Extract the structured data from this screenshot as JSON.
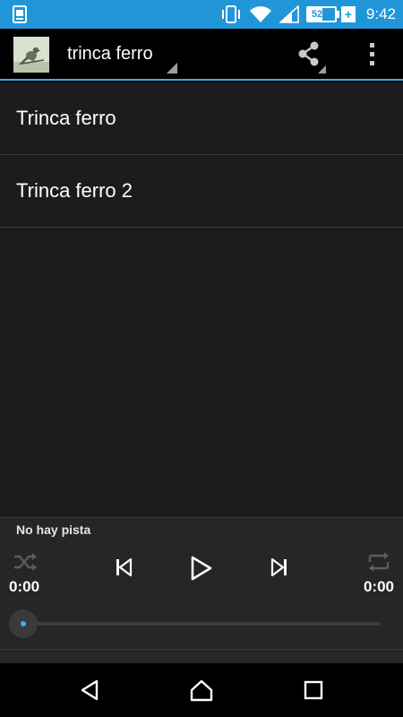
{
  "status_bar": {
    "time": "9:42",
    "battery_text": "52%",
    "battery_level": 0.52,
    "charging_glyph": "+",
    "icons": [
      "screenshot-notification-icon",
      "vibrate-icon",
      "wifi-icon",
      "cell-signal-icon",
      "battery-icon"
    ]
  },
  "action_bar": {
    "title": "trinca ferro",
    "thumbnail": "bird-thumbnail",
    "icons": [
      "share-icon",
      "overflow-menu-icon"
    ]
  },
  "list": {
    "items": [
      {
        "label": "Trinca ferro"
      },
      {
        "label": "Trinca ferro 2"
      }
    ]
  },
  "player": {
    "track_label": "No hay pista",
    "elapsed": "0:00",
    "total": "0:00",
    "progress": 0,
    "icons": [
      "shuffle-icon",
      "previous-icon",
      "play-icon",
      "next-icon",
      "repeat-icon"
    ]
  },
  "nav_bar": {
    "icons": [
      "back-icon",
      "home-icon",
      "recents-icon"
    ]
  },
  "colors": {
    "accent": "#33b5e5",
    "status_bar": "#2096d9",
    "list_bg": "#1c1c1c",
    "player_bg": "#262626"
  }
}
